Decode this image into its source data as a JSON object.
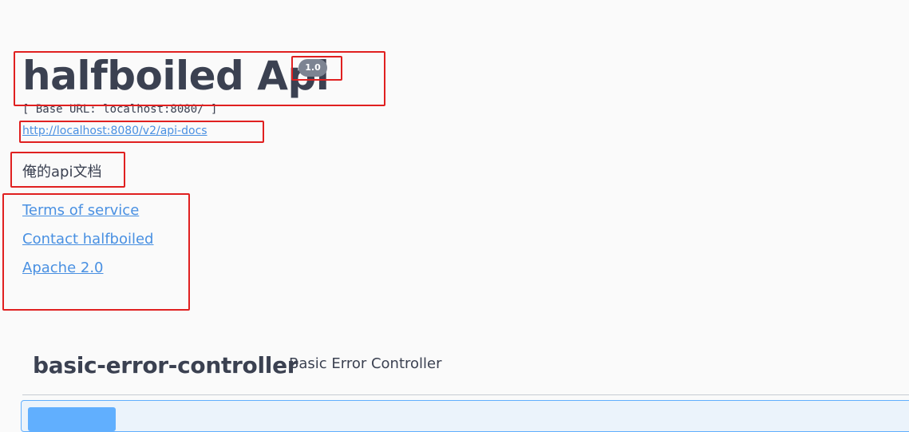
{
  "info": {
    "title": "halfboiled Api",
    "version": "1.0",
    "base_url": "[ Base URL: localhost:8080/ ]",
    "spec_url": "http://localhost:8080/v2/api-docs",
    "description": "俺的api文档",
    "links": [
      {
        "label": "Terms of service"
      },
      {
        "label": "Contact halfboiled"
      },
      {
        "label": "Apache 2.0"
      }
    ]
  },
  "tag": {
    "name": "basic-error-controller",
    "description": "Basic Error Controller"
  },
  "colors": {
    "text": "#3b4151",
    "link": "#4990e2",
    "badge": "#7d8492",
    "highlight_box": "#e02020",
    "get_method": "#61affe",
    "get_background": "#ebf3fb"
  }
}
